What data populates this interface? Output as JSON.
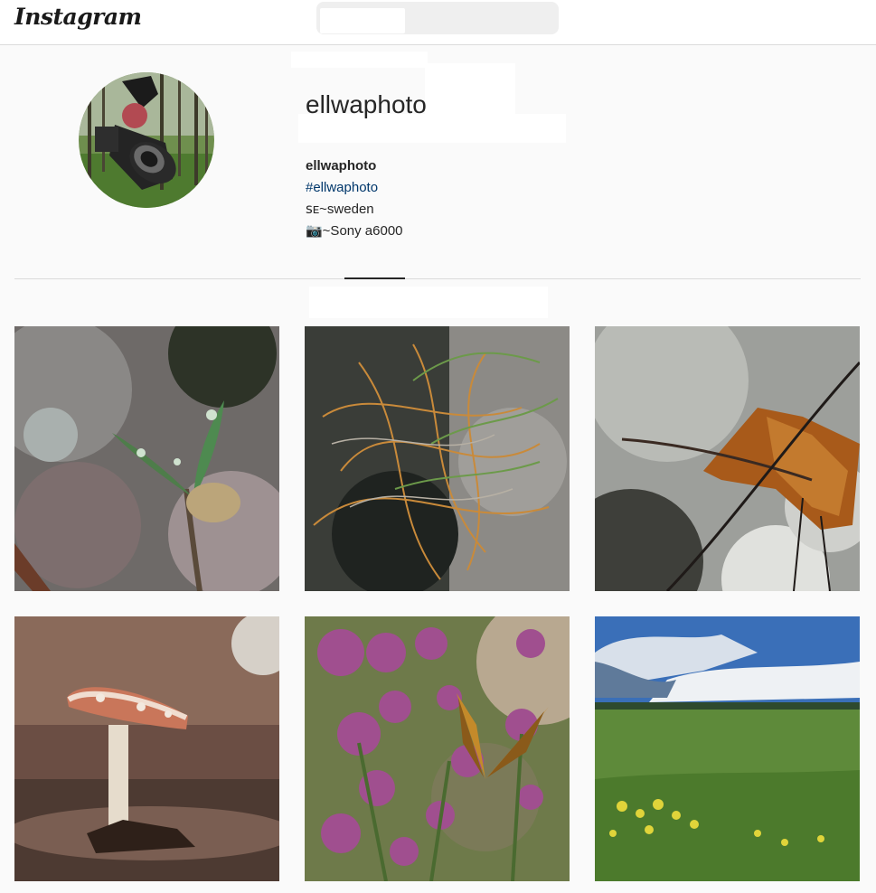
{
  "nav": {
    "logo": "Instagram",
    "search_placeholder": ""
  },
  "profile": {
    "username": "ellwaphoto",
    "full_name": "ellwaphoto",
    "hashtag": "#ellwaphoto",
    "location": "ꜱᴇ~sweden",
    "camera": "📷~Sony a6000"
  },
  "posts": [
    {
      "subject": "seedling with water droplets"
    },
    {
      "subject": "dry grass with dew drops"
    },
    {
      "subject": "autumn leaf on twig"
    },
    {
      "subject": "fly agaric mushroom"
    },
    {
      "subject": "butterfly on oregano flowers"
    },
    {
      "subject": "green field under cloudy sky"
    }
  ],
  "colors": {
    "background": "#fafafa",
    "link": "#00376b",
    "border": "#dbdbdb"
  }
}
